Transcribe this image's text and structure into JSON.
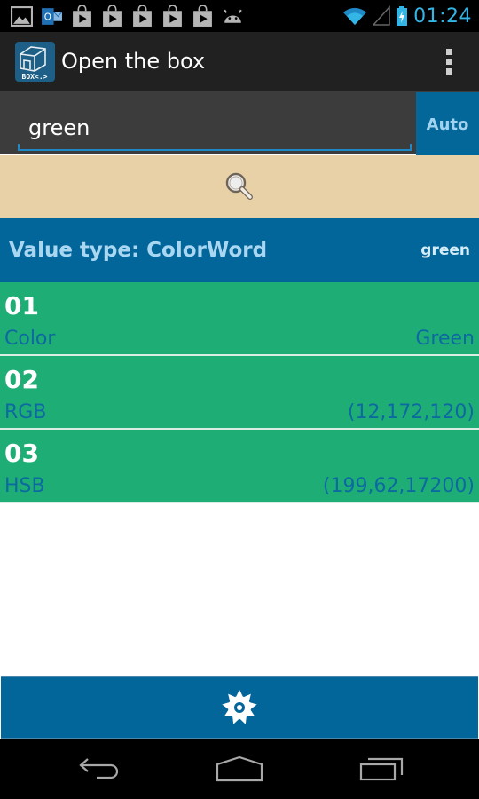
{
  "status_bar": {
    "notification_icons": [
      "gallery-icon",
      "outlook-icon",
      "play-store-icon",
      "play-store-icon",
      "play-store-icon",
      "play-store-icon",
      "play-store-icon",
      "android-icon"
    ],
    "wifi": "wifi-icon",
    "signal": "signal-icon",
    "battery": "battery-charging-icon",
    "time": "01:24"
  },
  "action_bar": {
    "app_icon_text": "BOX<.>",
    "title": "Open the box",
    "overflow_icon": "overflow-menu-icon"
  },
  "search": {
    "value": "green",
    "auto_label": "Auto",
    "search_icon": "search-icon"
  },
  "value_header": {
    "label": "Value type: ColorWord",
    "input": "green"
  },
  "results": [
    {
      "index": "01",
      "key": "Color",
      "value": "Green"
    },
    {
      "index": "02",
      "key": "RGB",
      "value": "(12,172,120)"
    },
    {
      "index": "03",
      "key": "HSB",
      "value": "(199,62,17200)"
    }
  ],
  "settings": {
    "icon": "gear-icon"
  },
  "nav_bar": {
    "back": "back-icon",
    "home": "home-icon",
    "recents": "recents-icon"
  },
  "colors": {
    "accent_blue": "#03669a",
    "result_green": "#1fad76",
    "search_button_bg": "#e8d1a7",
    "clock_blue": "#33b5e5"
  }
}
